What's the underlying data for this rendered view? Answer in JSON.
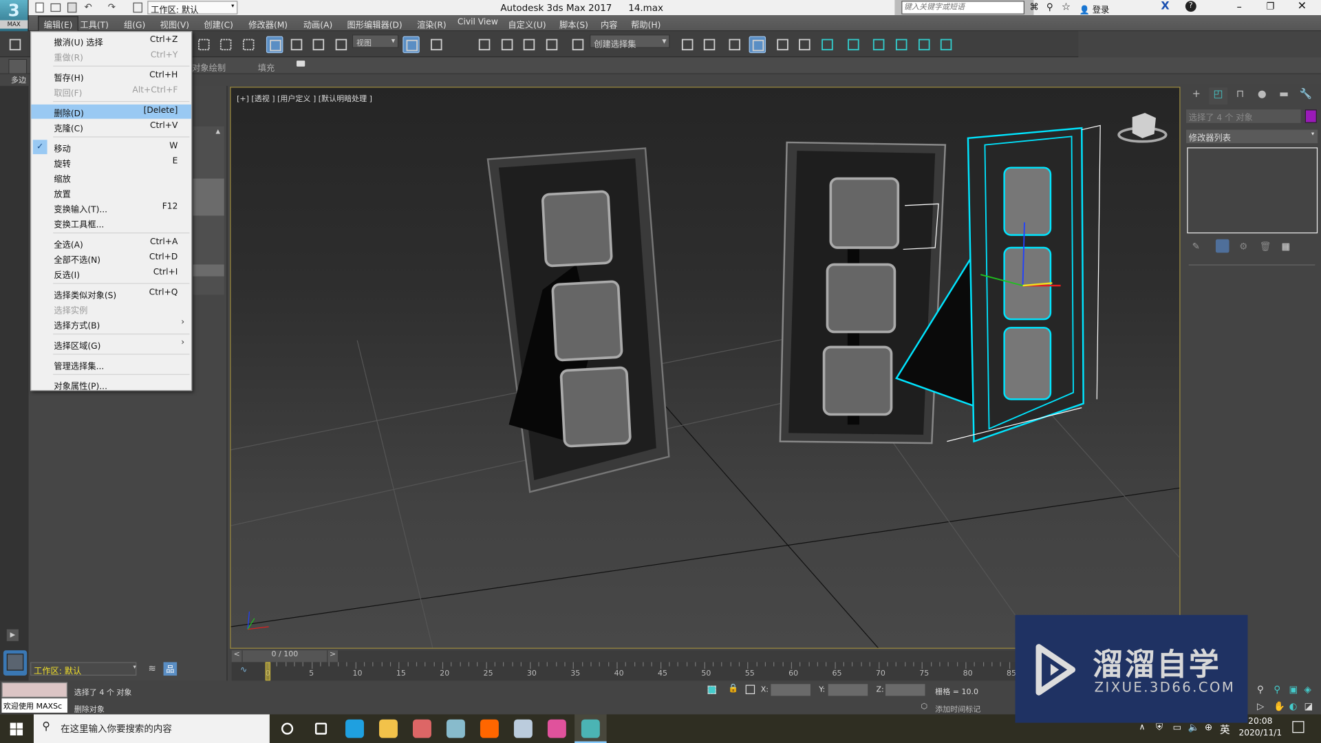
{
  "app": {
    "title": "Autodesk 3ds Max 2017",
    "file": "14.max",
    "logo_label": "MAX",
    "logo_number": "3",
    "workspace_top": "工作区: 默认",
    "search_placeholder": "键入关键字或短语",
    "login": "登录"
  },
  "menubar": [
    {
      "label": "编辑(E)",
      "active": true
    },
    {
      "label": "工具(T)"
    },
    {
      "label": "组(G)"
    },
    {
      "label": "视图(V)"
    },
    {
      "label": "创建(C)"
    },
    {
      "label": "修改器(M)"
    },
    {
      "label": "动画(A)"
    },
    {
      "label": "图形编辑器(D)"
    },
    {
      "label": "渲染(R)"
    },
    {
      "label": "Civil View"
    },
    {
      "label": "自定义(U)"
    },
    {
      "label": "脚本(S)"
    },
    {
      "label": "内容"
    },
    {
      "label": "帮助(H)"
    }
  ],
  "toolbar": {
    "view_dropdown": "视图",
    "selection_set": "创建选择集",
    "icons": [
      "undo-icon",
      "select-by-name-icon",
      "rect-select-icon",
      "window-crossing-icon",
      "move-icon",
      "rotate-icon",
      "scale-icon",
      "place-icon",
      "pivot-icon",
      "snap-3d-icon",
      "angle-snap-icon",
      "percent-snap-icon",
      "spinner-snap-icon",
      "edit-named-sets-icon",
      "mirror-icon",
      "align-icon",
      "layer-explorer-icon",
      "layers-icon",
      "scene-explorer-icon",
      "curve-editor-icon",
      "dope-sheet-icon",
      "schematic-icon",
      "render-setup-icon",
      "render-frame-icon",
      "render-icon",
      "render-cloud-icon",
      "viewport-layout-icon"
    ],
    "active_icons": [
      "move-icon",
      "pivot-icon",
      "scene-explorer-icon"
    ]
  },
  "ribbon": {
    "tabs": [
      "对象绘制",
      "填充"
    ],
    "sub_label": "多边"
  },
  "edit_menu": [
    {
      "label": "撤消(U) 选择",
      "shortcut": "Ctrl+Z"
    },
    {
      "label": "重做(R)",
      "shortcut": "Ctrl+Y",
      "disabled": true
    },
    {
      "sep": true
    },
    {
      "label": "暂存(H)",
      "shortcut": "Ctrl+H"
    },
    {
      "label": "取回(F)",
      "shortcut": "Alt+Ctrl+F",
      "disabled": true
    },
    {
      "sep": true
    },
    {
      "label": "删除(D)",
      "shortcut": "[Delete]",
      "highlighted": true
    },
    {
      "label": "克隆(C)",
      "shortcut": "Ctrl+V"
    },
    {
      "sep": true
    },
    {
      "label": "移动",
      "shortcut": "W",
      "checked": true
    },
    {
      "label": "旋转",
      "shortcut": "E"
    },
    {
      "label": "缩放",
      "shortcut": ""
    },
    {
      "label": "放置",
      "shortcut": ""
    },
    {
      "label": "变换输入(T)...",
      "shortcut": "F12"
    },
    {
      "label": "变换工具框...",
      "shortcut": ""
    },
    {
      "sep": true
    },
    {
      "label": "全选(A)",
      "shortcut": "Ctrl+A"
    },
    {
      "label": "全部不选(N)",
      "shortcut": "Ctrl+D"
    },
    {
      "label": "反选(I)",
      "shortcut": "Ctrl+I"
    },
    {
      "sep": true
    },
    {
      "label": "选择类似对象(S)",
      "shortcut": "Ctrl+Q"
    },
    {
      "label": "选择实例",
      "shortcut": "",
      "disabled": true
    },
    {
      "label": "选择方式(B)",
      "shortcut": "",
      "submenu": true
    },
    {
      "sep": true
    },
    {
      "label": "选择区域(G)",
      "shortcut": "",
      "submenu": true
    },
    {
      "sep": true
    },
    {
      "label": "管理选择集...",
      "shortcut": ""
    },
    {
      "sep": true
    },
    {
      "label": "对象属性(P)...",
      "shortcut": ""
    }
  ],
  "viewport": {
    "label": "[+] [透视 ] [用户定义 ] [默认明暗处理 ]",
    "selection_color": "#00e5ff"
  },
  "command_panel": {
    "tabs": [
      "create-icon",
      "modify-icon",
      "hierarchy-icon",
      "motion-icon",
      "display-icon",
      "utilities-icon"
    ],
    "selection_name": "选择了 4 个 对象",
    "object_color": "#9a1ab8",
    "modifier_list": "修改器列表"
  },
  "explorer": {
    "workspace": "工作区: 默认"
  },
  "timeline": {
    "frame_display": "0 / 100",
    "current_frame": 0,
    "total_frames": 100,
    "tick_labels": [
      0,
      5,
      10,
      15,
      20,
      25,
      30,
      35,
      40,
      45,
      50,
      55,
      60,
      65,
      70,
      75,
      80,
      85
    ]
  },
  "status": {
    "maxscript": "欢迎使用 MAXSc",
    "selection": "选择了 4 个 对象",
    "prompt": "删除对象",
    "x_label": "X:",
    "y_label": "Y:",
    "z_label": "Z:",
    "x": "",
    "y": "",
    "z": "",
    "grid": "栅格 = 10.0",
    "add_time_tag": "添加时间标记"
  },
  "watermark": {
    "brand": "溜溜自学",
    "url": "ZIXUE.3D66.COM"
  },
  "taskbar": {
    "search_placeholder": "在这里输入你要搜索的内容",
    "apps": [
      "cortana-icon",
      "task-view-icon",
      "edge-icon",
      "file-explorer-icon",
      "app-icon",
      "paint-icon",
      "firefox-icon",
      "notepad-icon",
      "media-icon",
      "3dsmax-icon"
    ],
    "ime": "英",
    "time": "20:08",
    "date": "2020/11/1"
  }
}
